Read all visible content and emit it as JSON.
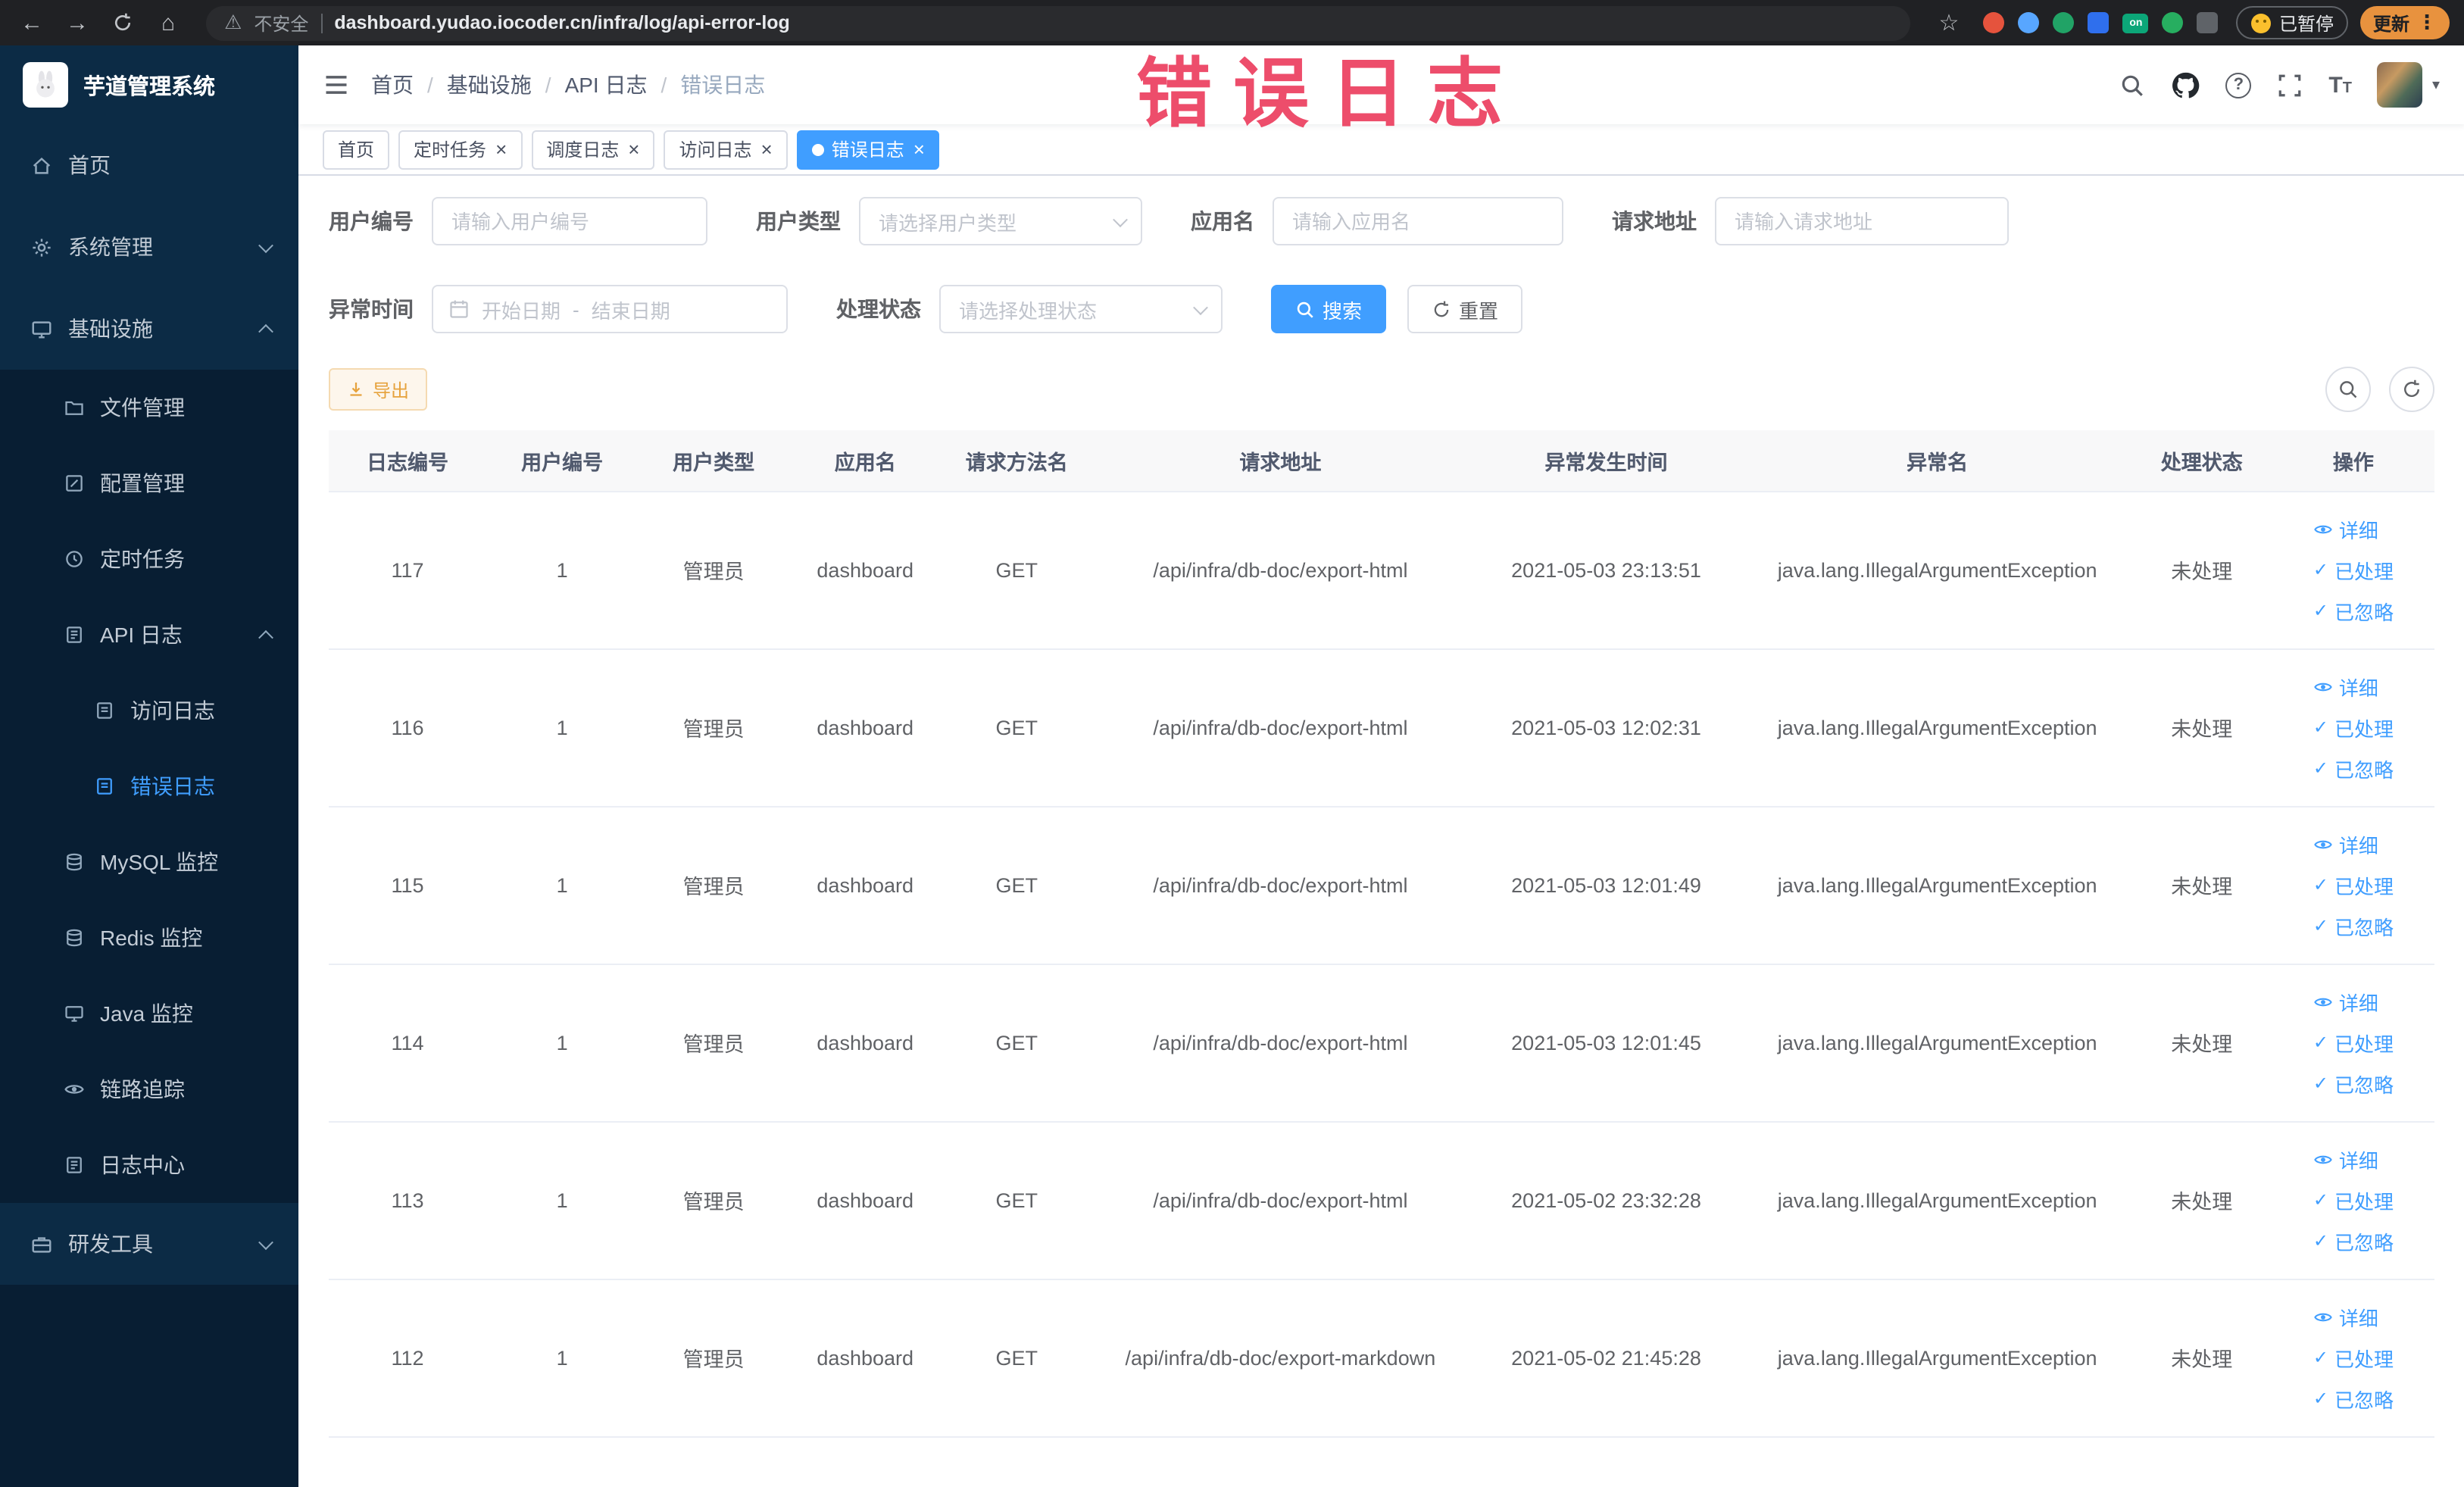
{
  "browser": {
    "security_label": "不安全",
    "url": "dashboard.yudao.iocoder.cn/infra/log/api-error-log",
    "paused_label": "已暂停",
    "update_label": "更新"
  },
  "watermark": {
    "text": "错误日志",
    "color": "#ec4060"
  },
  "theme": {
    "accent": "#409eff",
    "sidebar_bg": "#0c2b45",
    "submenu_bg": "#081e33",
    "warning": "#e6a23c"
  },
  "sidebar": {
    "logo_title": "芋道管理系统",
    "items": [
      {
        "label": "首页",
        "icon": "home-icon",
        "depth": 1
      },
      {
        "label": "系统管理",
        "icon": "gear-icon",
        "depth": 1,
        "arrow": "down"
      },
      {
        "label": "基础设施",
        "icon": "monitor-icon",
        "depth": 1,
        "arrow": "up"
      },
      {
        "label": "文件管理",
        "icon": "folder-icon",
        "depth": 2
      },
      {
        "label": "配置管理",
        "icon": "edit-icon",
        "depth": 2
      },
      {
        "label": "定时任务",
        "icon": "clock-icon",
        "depth": 2
      },
      {
        "label": "API 日志",
        "icon": "note-icon",
        "depth": 2,
        "arrow": "up"
      },
      {
        "label": "访问日志",
        "icon": "doc-icon",
        "depth": 3
      },
      {
        "label": "错误日志",
        "icon": "doc-icon",
        "depth": 3,
        "active": true
      },
      {
        "label": "MySQL 监控",
        "icon": "database-icon",
        "depth": 2
      },
      {
        "label": "Redis 监控",
        "icon": "database-icon",
        "depth": 2
      },
      {
        "label": "Java 监控",
        "icon": "monitor-icon",
        "depth": 2
      },
      {
        "label": "链路追踪",
        "icon": "eye-icon",
        "depth": 2
      },
      {
        "label": "日志中心",
        "icon": "doc-icon",
        "depth": 2
      },
      {
        "label": "研发工具",
        "icon": "toolbox-icon",
        "depth": 1,
        "arrow": "down"
      }
    ]
  },
  "header": {
    "breadcrumb": [
      "首页",
      "基础设施",
      "API 日志",
      "错误日志"
    ]
  },
  "tabs": [
    {
      "label": "首页",
      "closable": false,
      "active": false
    },
    {
      "label": "定时任务",
      "closable": true,
      "active": false
    },
    {
      "label": "调度日志",
      "closable": true,
      "active": false
    },
    {
      "label": "访问日志",
      "closable": true,
      "active": false
    },
    {
      "label": "错误日志",
      "closable": true,
      "active": true
    }
  ],
  "filters": {
    "user_id": {
      "label": "用户编号",
      "placeholder": "请输入用户编号"
    },
    "user_type": {
      "label": "用户类型",
      "placeholder": "请选择用户类型"
    },
    "app_name": {
      "label": "应用名",
      "placeholder": "请输入应用名"
    },
    "request_url": {
      "label": "请求地址",
      "placeholder": "请输入请求地址"
    },
    "exception_time": {
      "label": "异常时间",
      "start_placeholder": "开始日期",
      "separator": "-",
      "end_placeholder": "结束日期"
    },
    "process_status": {
      "label": "处理状态",
      "placeholder": "请选择处理状态"
    },
    "search_label": "搜索",
    "reset_label": "重置"
  },
  "toolbar": {
    "export_label": "导出"
  },
  "table": {
    "headers": [
      "日志编号",
      "用户编号",
      "用户类型",
      "应用名",
      "请求方法名",
      "请求地址",
      "异常发生时间",
      "异常名",
      "处理状态",
      "操作"
    ],
    "actions": [
      "详细",
      "已处理",
      "已忽略"
    ],
    "rows": [
      {
        "id": "117",
        "user_id": "1",
        "user_type": "管理员",
        "app": "dashboard",
        "method": "GET",
        "url": "/api/infra/db-doc/export-html",
        "time": "2021-05-03 23:13:51",
        "exception": "java.lang.IllegalArgumentException",
        "status": "未处理"
      },
      {
        "id": "116",
        "user_id": "1",
        "user_type": "管理员",
        "app": "dashboard",
        "method": "GET",
        "url": "/api/infra/db-doc/export-html",
        "time": "2021-05-03 12:02:31",
        "exception": "java.lang.IllegalArgumentException",
        "status": "未处理"
      },
      {
        "id": "115",
        "user_id": "1",
        "user_type": "管理员",
        "app": "dashboard",
        "method": "GET",
        "url": "/api/infra/db-doc/export-html",
        "time": "2021-05-03 12:01:49",
        "exception": "java.lang.IllegalArgumentException",
        "status": "未处理"
      },
      {
        "id": "114",
        "user_id": "1",
        "user_type": "管理员",
        "app": "dashboard",
        "method": "GET",
        "url": "/api/infra/db-doc/export-html",
        "time": "2021-05-03 12:01:45",
        "exception": "java.lang.IllegalArgumentException",
        "status": "未处理"
      },
      {
        "id": "113",
        "user_id": "1",
        "user_type": "管理员",
        "app": "dashboard",
        "method": "GET",
        "url": "/api/infra/db-doc/export-html",
        "time": "2021-05-02 23:32:28",
        "exception": "java.lang.IllegalArgumentException",
        "status": "未处理"
      },
      {
        "id": "112",
        "user_id": "1",
        "user_type": "管理员",
        "app": "dashboard",
        "method": "GET",
        "url": "/api/infra/db-doc/export-markdown",
        "time": "2021-05-02 21:45:28",
        "exception": "java.lang.IllegalArgumentException",
        "status": "未处理"
      }
    ]
  }
}
